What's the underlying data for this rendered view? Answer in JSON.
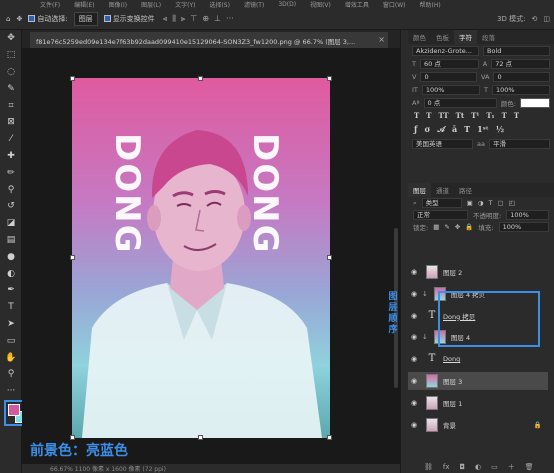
{
  "menubar": {
    "items": [
      "文件(F)",
      "编辑(E)",
      "图像(I)",
      "图层(L)",
      "文字(Y)",
      "选择(S)",
      "滤镜(T)",
      "3D(D)",
      "视图(V)",
      "增效工具",
      "窗口(W)",
      "帮助(H)"
    ]
  },
  "optionsbar": {
    "auto_select_label": "自动选择:",
    "auto_select_value": "图层",
    "show_transform_label": "显示变换控件",
    "right_label": "3D 模式:"
  },
  "document": {
    "tab_title": "f81e76c5259ed09e134e7f63b92daad099410e15129064-SON3Z3_fw1200.png @ 66.7% (图层 3,...",
    "close_glyph": "×",
    "artwork_text": "DONG",
    "status_text": "66.67%  1100 像素 x 1600 像素 (72 ppi)"
  },
  "annotations": {
    "foreground_caption": "前景色：亮蓝色",
    "layer_order_caption": "图层顺序"
  },
  "colors": {
    "foreground": "#d35b9d",
    "background": "#7fe1e6",
    "accent": "#3d8ee6"
  },
  "character_panel": {
    "tabs": [
      "颜色",
      "色板",
      "字符",
      "段落"
    ],
    "font_family": "Akzidenz-Grote...",
    "font_style": "Bold",
    "font_size": "60 点",
    "leading": "72 点",
    "kerning": "0",
    "tracking": "0",
    "vertical_scale": "100%",
    "horizontal_scale": "100%",
    "baseline_shift": "0 点",
    "color_label": "颜色:",
    "language": "美国英语",
    "anti_alias": "平滑",
    "type_buttons": [
      "T",
      "T",
      "TT",
      "Tt",
      "T¹",
      "T₁",
      "T",
      "T"
    ]
  },
  "layers_panel": {
    "tabs": [
      "图层",
      "通道",
      "路径"
    ],
    "filter_kind": "类型",
    "blend_mode": "正常",
    "opacity_label": "不透明度:",
    "opacity_value": "100%",
    "lock_label": "锁定:",
    "fill_label": "填充:",
    "fill_value": "100%",
    "layers": [
      {
        "name": "图层 2",
        "kind": "pic",
        "clipped": false,
        "selected": false
      },
      {
        "name": "图层 4 拷贝",
        "kind": "grad",
        "clipped": true,
        "selected": false
      },
      {
        "name": "Dong 拷贝",
        "kind": "text",
        "clipped": false,
        "selected": false
      },
      {
        "name": "图层 4",
        "kind": "grad",
        "clipped": true,
        "selected": false
      },
      {
        "name": "Dong",
        "kind": "text",
        "clipped": false,
        "selected": false
      },
      {
        "name": "图层 3",
        "kind": "grad",
        "clipped": false,
        "selected": true
      },
      {
        "name": "图层 1",
        "kind": "pic",
        "clipped": false,
        "selected": false
      },
      {
        "name": "背景",
        "kind": "pic",
        "clipped": false,
        "selected": false,
        "locked": true
      }
    ]
  }
}
